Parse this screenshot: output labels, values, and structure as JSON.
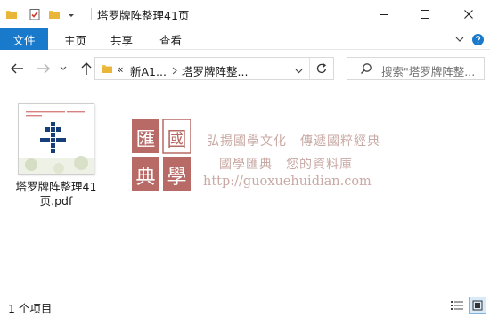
{
  "window": {
    "title": "塔罗牌阵整理41页"
  },
  "ribbon": {
    "tabs": [
      "文件",
      "主页",
      "共享",
      "查看"
    ]
  },
  "address": {
    "overflow_chevron": "«",
    "crumbs": [
      "新A1...",
      "塔罗牌阵整..."
    ]
  },
  "search": {
    "placeholder": "搜索\"塔罗牌阵整..."
  },
  "files": [
    {
      "name_line1": "塔罗牌阵整理41",
      "name_line2": "页.pdf",
      "icon": "pdf-thumbnail"
    }
  ],
  "watermark": {
    "seal_chars": [
      "匯",
      "國",
      "典",
      "學"
    ],
    "line1": "弘揚國學文化　傳遞國粹經典",
    "line2": "國學匯典　您的資料庫",
    "url": "http://guoxuehuidian.com"
  },
  "status": {
    "item_count": "1 个项目"
  },
  "colors": {
    "accent": "#1979ca",
    "folder": "#f3c246",
    "seal": "#b86a66",
    "watermark_text": "#c9a9a4",
    "thumb_cross": "#163f7a"
  }
}
